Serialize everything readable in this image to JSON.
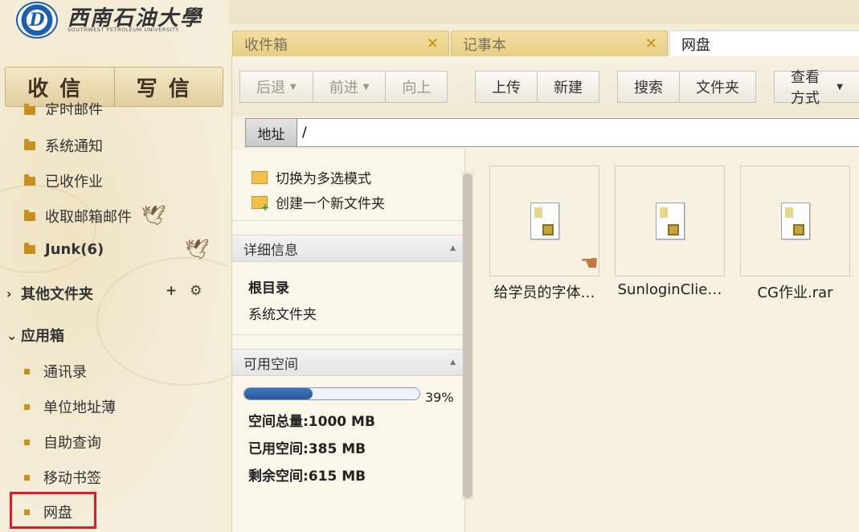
{
  "brand": {
    "logo_letter": "D",
    "title": "西南石油大學",
    "subtitle": "SOUTHWEST PETROLEUM UNIVERSITY"
  },
  "compose": {
    "receive_label": "收信",
    "write_label": "写信"
  },
  "sidebar": {
    "partial_item": "定时邮件",
    "folders": [
      {
        "label": "系统通知",
        "bold": false
      },
      {
        "label": "已收作业",
        "bold": false
      },
      {
        "label": "收取邮箱邮件",
        "bold": false
      },
      {
        "label": "Junk(6)",
        "bold": true
      }
    ],
    "other_folders": {
      "label": "其他文件夹",
      "add_icon": "+",
      "settings_icon": "⚙"
    },
    "app_box": {
      "label": "应用箱",
      "items": [
        "通讯录",
        "单位地址薄",
        "自助查询",
        "移动书签",
        "网盘"
      ]
    }
  },
  "tabs": [
    {
      "label": "收件箱",
      "closable": true,
      "active": false
    },
    {
      "label": "记事本",
      "closable": true,
      "active": false
    },
    {
      "label": "网盘",
      "closable": false,
      "active": true
    }
  ],
  "toolbar": {
    "back": "后退",
    "forward": "前进",
    "up": "向上",
    "upload": "上传",
    "new": "新建",
    "search": "搜索",
    "folder": "文件夹",
    "view": "查看方式"
  },
  "address": {
    "label": "地址",
    "value": "/"
  },
  "info_pane": {
    "actions": [
      "切换为多选模式",
      "创建一个新文件夹"
    ],
    "details_header": "详细信息",
    "current_name": "根目录",
    "current_type": "系统文件夹",
    "space_header": "可用空间",
    "usage_fraction": 0.39,
    "usage_pct_text": "39%",
    "total": "空间总量:1000 MB",
    "used": "已用空间:385 MB",
    "free": "剩余空间:615 MB"
  },
  "files": [
    {
      "name": "给学员的字体…",
      "shared": true
    },
    {
      "name": "SunloginClie…",
      "shared": false
    },
    {
      "name": "CG作业.rar",
      "shared": false
    }
  ],
  "colors": {
    "highlight": "#e01c2a",
    "folder": "#c98f1c",
    "progress": "#2a5a9e"
  }
}
